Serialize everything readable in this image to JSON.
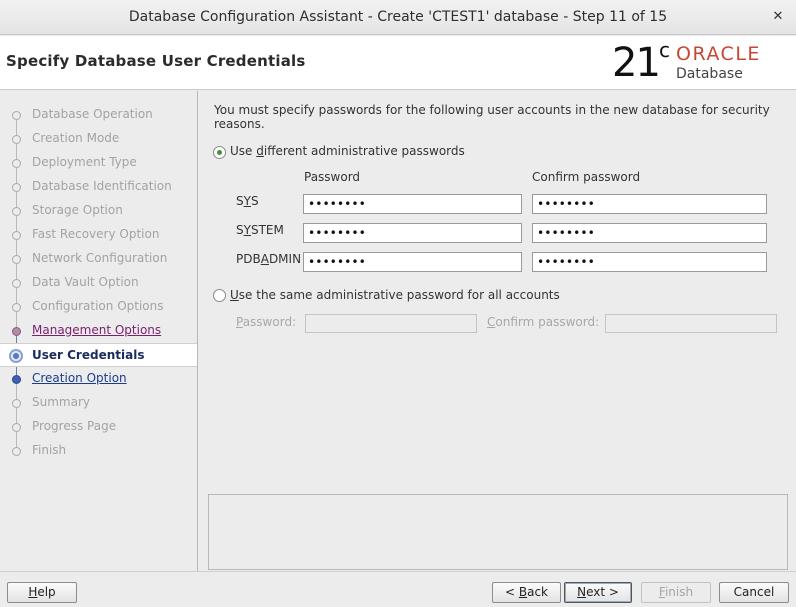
{
  "window": {
    "title": "Database Configuration Assistant - Create 'CTEST1' database - Step 11 of 15",
    "close_icon": "close-icon"
  },
  "header": {
    "page_title": "Specify Database User Credentials",
    "logo": {
      "version": "21",
      "version_sup": "c",
      "brand": "ORACLE",
      "product": "Database",
      "brand_color": "#c74634"
    }
  },
  "steps": [
    {
      "label": "Database Operation",
      "state": "done"
    },
    {
      "label": "Creation Mode",
      "state": "done"
    },
    {
      "label": "Deployment Type",
      "state": "done"
    },
    {
      "label": "Database Identification",
      "state": "done"
    },
    {
      "label": "Storage Option",
      "state": "done"
    },
    {
      "label": "Fast Recovery Option",
      "state": "done"
    },
    {
      "label": "Network Configuration",
      "state": "done"
    },
    {
      "label": "Data Vault Option",
      "state": "done"
    },
    {
      "label": "Configuration Options",
      "state": "done"
    },
    {
      "label": "Management Options",
      "state": "visited"
    },
    {
      "label": "User Credentials",
      "state": "current"
    },
    {
      "label": "Creation Option",
      "state": "next"
    },
    {
      "label": "Summary",
      "state": "pending"
    },
    {
      "label": "Progress Page",
      "state": "pending"
    },
    {
      "label": "Finish",
      "state": "pending"
    }
  ],
  "content": {
    "intro": "You must specify passwords for the following user accounts in the new database for security reasons.",
    "option_different": {
      "pre": "Use ",
      "mnemonic": "d",
      "post": "ifferent administrative passwords",
      "selected": true
    },
    "col_password": "Password",
    "col_confirm": "Confirm password",
    "accounts": [
      {
        "pre": "S",
        "mnemonic": "Y",
        "post": "S",
        "password": "••••••••",
        "confirm": "••••••••"
      },
      {
        "pre": "S",
        "mnemonic": "Y",
        "post": "STEM",
        "password": "••••••••",
        "confirm": "••••••••"
      },
      {
        "pre": "PDB",
        "mnemonic": "A",
        "post": "DMIN",
        "password": "••••••••",
        "confirm": "••••••••"
      }
    ],
    "option_same": {
      "pre": "",
      "mnemonic": "U",
      "post": "se the same administrative password for all accounts",
      "selected": false
    },
    "same_password_label": {
      "pre": "",
      "mnemonic": "P",
      "post": "assword:"
    },
    "same_confirm_label": {
      "pre": "",
      "mnemonic": "C",
      "post": "onfirm password:"
    },
    "same_password_value": "",
    "same_confirm_value": ""
  },
  "buttons": {
    "help": {
      "pre": "",
      "mnemonic": "H",
      "post": "elp"
    },
    "back": {
      "pre": "< ",
      "mnemonic": "B",
      "post": "ack"
    },
    "next": {
      "pre": "",
      "mnemonic": "N",
      "post": "ext >"
    },
    "finish": {
      "pre": "",
      "mnemonic": "F",
      "post": "inish"
    },
    "cancel": {
      "pre": "Cancel",
      "mnemonic": "",
      "post": ""
    }
  }
}
